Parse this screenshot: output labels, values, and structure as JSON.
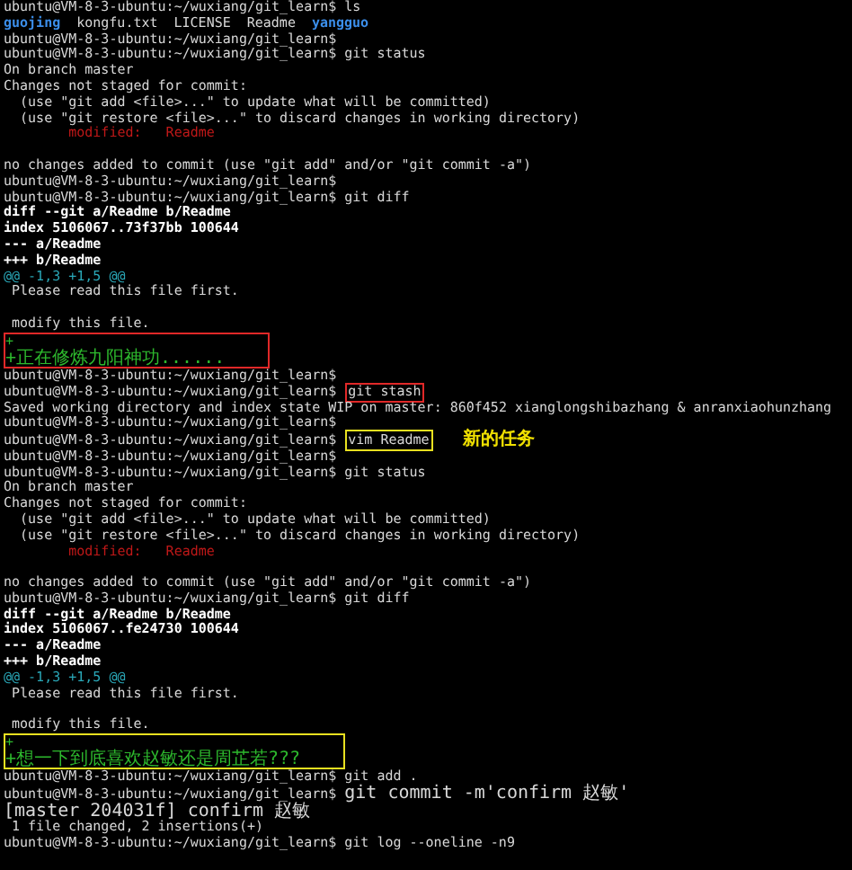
{
  "terminal": {
    "blocks": [
      {
        "segments": [
          {
            "kind": "prompt",
            "text": "ubuntu@VM-8-3-ubuntu:~/wuxiang/git_learn$"
          },
          {
            "kind": "cmd",
            "text": "ls"
          }
        ]
      },
      {
        "segments": [
          {
            "kind": "dir",
            "text": "guojing"
          },
          {
            "kind": "text",
            "text": "kongfu.txt"
          },
          {
            "kind": "text",
            "text": "LICENSE"
          },
          {
            "kind": "text",
            "text": "Readme"
          },
          {
            "kind": "dir",
            "text": "yangguo"
          }
        ]
      },
      {
        "segments": [
          {
            "kind": "prompt",
            "text": "ubuntu@VM-8-3-ubuntu:~/wuxiang/git_learn$"
          }
        ]
      },
      {
        "segments": [
          {
            "kind": "prompt",
            "text": "ubuntu@VM-8-3-ubuntu:~/wuxiang/git_learn$"
          },
          {
            "kind": "cmd",
            "text": "git status"
          }
        ]
      },
      {
        "segments": [
          {
            "kind": "text",
            "text": "On branch master"
          }
        ]
      },
      {
        "segments": [
          {
            "kind": "text",
            "text": "Changes not staged for commit:"
          }
        ]
      },
      {
        "segments": [
          {
            "kind": "text",
            "text": "  (use \"git add <file>...\" to update what will be committed)"
          }
        ]
      },
      {
        "segments": [
          {
            "kind": "text",
            "text": "  (use \"git restore <file>...\" to discard changes in working directory)"
          }
        ]
      },
      {
        "segments": [
          {
            "kind": "red",
            "text": "        modified:   Readme"
          }
        ]
      },
      {
        "blank_line_before": true,
        "segments": [
          {
            "kind": "text",
            "text": "no changes added to commit (use \"git add\" and/or \"git commit -a\")"
          }
        ]
      },
      {
        "segments": [
          {
            "kind": "prompt",
            "text": "ubuntu@VM-8-3-ubuntu:~/wuxiang/git_learn$"
          }
        ]
      },
      {
        "segments": [
          {
            "kind": "prompt",
            "text": "ubuntu@VM-8-3-ubuntu:~/wuxiang/git_learn$"
          },
          {
            "kind": "cmd",
            "text": "git diff"
          }
        ]
      },
      {
        "segments": [
          {
            "kind": "bold",
            "text": "diff --git a/Readme b/Readme"
          }
        ]
      },
      {
        "segments": [
          {
            "kind": "bold",
            "text": "index 5106067..73f37bb 100644"
          }
        ]
      },
      {
        "segments": [
          {
            "kind": "bold",
            "text": "--- a/Readme"
          }
        ]
      },
      {
        "segments": [
          {
            "kind": "bold",
            "text": "+++ b/Readme"
          }
        ]
      },
      {
        "segments": [
          {
            "kind": "hunk",
            "text": "@@ -1,3 +1,5 @@"
          }
        ]
      },
      {
        "segments": [
          {
            "kind": "text",
            "text": " Please read this file first."
          }
        ]
      },
      {
        "blank_line_before": true,
        "segments": [
          {
            "kind": "text",
            "text": " modify this file."
          }
        ]
      },
      {
        "color": "#e02828",
        "lines": [
          {
            "segments": [
              {
                "kind": "added",
                "text": "+"
              }
            ]
          },
          {
            "segments": [
              {
                "kind": "added",
                "text": "+正在修炼九阳神功......"
              }
            ]
          }
        ]
      },
      {
        "segments": [
          {
            "kind": "prompt",
            "text": "ubuntu@VM-8-3-ubuntu:~/wuxiang/git_learn$"
          }
        ]
      },
      {
        "segments": [
          {
            "kind": "prompt",
            "text": "ubuntu@VM-8-3-ubuntu:~/wuxiang/git_learn$"
          },
          {
            "kind": "cmd",
            "text": "git stash",
            "color": "#e02828"
          }
        ]
      },
      {
        "segments": [
          {
            "kind": "text",
            "text": "Saved working directory and index state WIP on master: 860f452 xianglongshibazhang & anranxiaohunzhang"
          }
        ]
      },
      {
        "segments": [
          {
            "kind": "prompt",
            "text": "ubuntu@VM-8-3-ubuntu:~/wuxiang/git_learn$"
          }
        ]
      },
      {
        "segments": [
          {
            "kind": "prompt",
            "text": "ubuntu@VM-8-3-ubuntu:~/wuxiang/git_learn$"
          },
          {
            "kind": "cmd",
            "text": "vim Readme",
            "color": "#e8e020"
          },
          {
            "kind": "note",
            "text": "新的任务"
          }
        ]
      },
      {
        "segments": [
          {
            "kind": "prompt",
            "text": "ubuntu@VM-8-3-ubuntu:~/wuxiang/git_learn$"
          }
        ]
      },
      {
        "segments": [
          {
            "kind": "prompt",
            "text": "ubuntu@VM-8-3-ubuntu:~/wuxiang/git_learn$"
          },
          {
            "kind": "cmd",
            "text": "git status"
          }
        ]
      },
      {
        "segments": [
          {
            "kind": "text",
            "text": "On branch master"
          }
        ]
      },
      {
        "segments": [
          {
            "kind": "text",
            "text": "Changes not staged for commit:"
          }
        ]
      },
      {
        "segments": [
          {
            "kind": "text",
            "text": "  (use \"git add <file>...\" to update what will be committed)"
          }
        ]
      },
      {
        "segments": [
          {
            "kind": "text",
            "text": "  (use \"git restore <file>...\" to discard changes in working directory)"
          }
        ]
      },
      {
        "segments": [
          {
            "kind": "red",
            "text": "        modified:   Readme"
          }
        ]
      },
      {
        "blank_line_before": true,
        "segments": [
          {
            "kind": "text",
            "text": "no changes added to commit (use \"git add\" and/or \"git commit -a\")"
          }
        ]
      },
      {
        "segments": [
          {
            "kind": "prompt",
            "text": "ubuntu@VM-8-3-ubuntu:~/wuxiang/git_learn$"
          },
          {
            "kind": "cmd",
            "text": "git diff"
          }
        ]
      },
      {
        "segments": [
          {
            "kind": "bold",
            "text": "diff --git a/Readme b/Readme"
          }
        ]
      },
      {
        "segments": [
          {
            "kind": "bold",
            "text": "index 5106067..fe24730 100644"
          }
        ]
      },
      {
        "segments": [
          {
            "kind": "bold",
            "text": "--- a/Readme"
          }
        ]
      },
      {
        "segments": [
          {
            "kind": "bold",
            "text": "+++ b/Readme"
          }
        ]
      },
      {
        "segments": [
          {
            "kind": "hunk",
            "text": "@@ -1,3 +1,5 @@"
          }
        ]
      },
      {
        "segments": [
          {
            "kind": "text",
            "text": " Please read this file first."
          }
        ]
      },
      {
        "blank_line_before": true,
        "segments": [
          {
            "kind": "text",
            "text": " modify this file."
          }
        ]
      },
      {
        "color": "#e8e020",
        "lines": [
          {
            "segments": [
              {
                "kind": "added",
                "text": "+"
              }
            ]
          },
          {
            "segments": [
              {
                "kind": "added",
                "text": "+想一下到底喜欢赵敏还是周芷若???"
              }
            ]
          }
        ]
      },
      {
        "segments": [
          {
            "kind": "prompt",
            "text": "ubuntu@VM-8-3-ubuntu:~/wuxiang/git_learn$"
          },
          {
            "kind": "cmd",
            "text": "git add ."
          }
        ]
      },
      {
        "segments": [
          {
            "kind": "prompt",
            "text": "ubuntu@VM-8-3-ubuntu:~/wuxiang/git_learn$"
          },
          {
            "kind": "cmd",
            "text": "git commit -m'confirm 赵敏'"
          }
        ]
      },
      {
        "segments": [
          {
            "kind": "text",
            "text": "[master 204031f] confirm 赵敏"
          }
        ]
      },
      {
        "segments": [
          {
            "kind": "text",
            "text": " 1 file changed, 2 insertions(+)"
          }
        ]
      },
      {
        "segments": [
          {
            "kind": "prompt",
            "text": "ubuntu@VM-8-3-ubuntu:~/wuxiang/git_learn$"
          },
          {
            "kind": "cmd",
            "text": "git log --oneline -n9"
          }
        ]
      }
    ]
  }
}
